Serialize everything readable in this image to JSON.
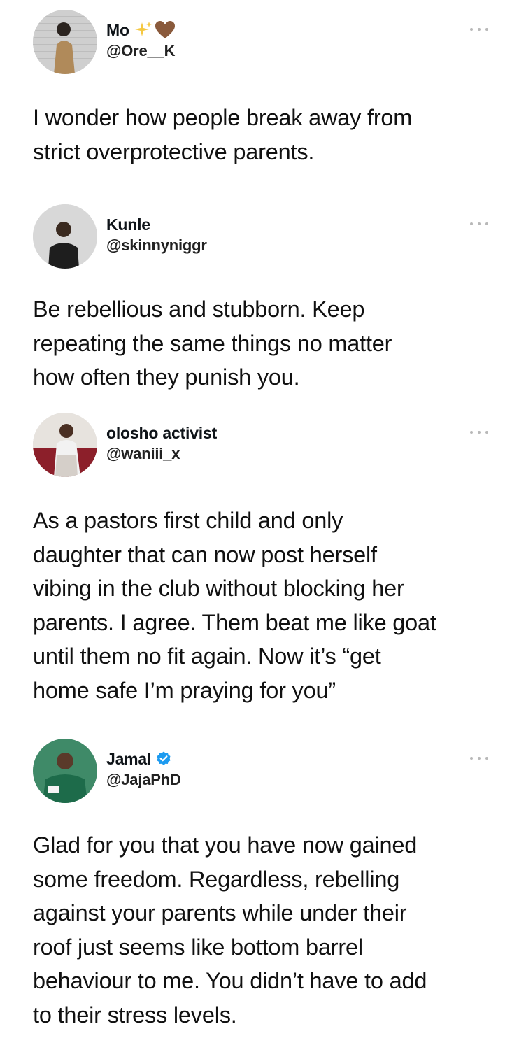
{
  "tweets": [
    {
      "name": "Mo",
      "handle": "@Ore__K",
      "text": "I wonder how people break away from\nstrict overprotective parents."
    },
    {
      "name": "Kunle",
      "handle": "@skinnyniggr",
      "text": "Be rebellious and stubborn. Keep\nrepeating the same things no matter\nhow often they punish you."
    },
    {
      "name": "olosho activist",
      "handle": "@waniii_x",
      "text": "As a pastors first child and only\ndaughter that can now post herself\nvibing in the club without blocking her\nparents. I agree. Them beat me like goat\nuntil them no fit again. Now it’s “get\nhome safe I’m praying for you”"
    },
    {
      "name": "Jamal",
      "handle": "@JajaPhD",
      "text": "Glad for you that you have now gained\nsome freedom. Regardless, rebelling\nagainst your parents while under their\nroof just seems like bottom barrel\nbehaviour to me. You didn’t have to add\nto their stress levels."
    }
  ],
  "colors": {
    "verified": "#1d9bf0",
    "more_dots": "#b8b8b8",
    "heart": "#8a5a3c",
    "sparkle": "#f5c842"
  },
  "icons": [
    "sparkles-icon",
    "brown-heart-icon",
    "verified-badge-icon",
    "more-options-icon"
  ]
}
